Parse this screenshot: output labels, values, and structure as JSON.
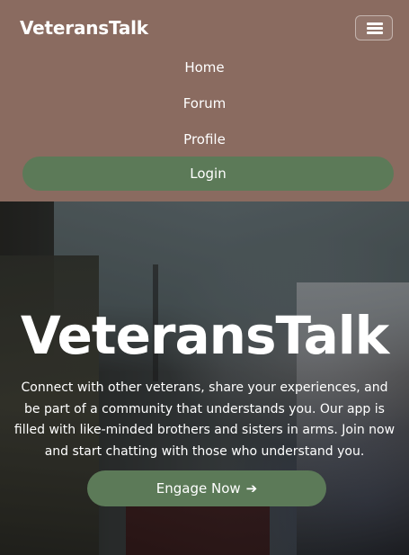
{
  "navbar": {
    "brand": "VeteransTalk",
    "toggle_icon": "hamburger-menu-icon",
    "links": [
      {
        "label": "Home"
      },
      {
        "label": "Forum"
      },
      {
        "label": "Profile"
      }
    ],
    "login_label": "Login",
    "background_color": "#8a6b60",
    "accent_color": "#5c7a58"
  },
  "hero": {
    "title": "VeteransTalk",
    "description": "Connect with other veterans, share your experiences, and be part of a community that understands you. Our app is filled with like-minded brothers and sisters in arms. Join now and start chatting with those who understand you.",
    "cta_label": "Engage Now",
    "cta_icon": "arrow-right-icon"
  }
}
